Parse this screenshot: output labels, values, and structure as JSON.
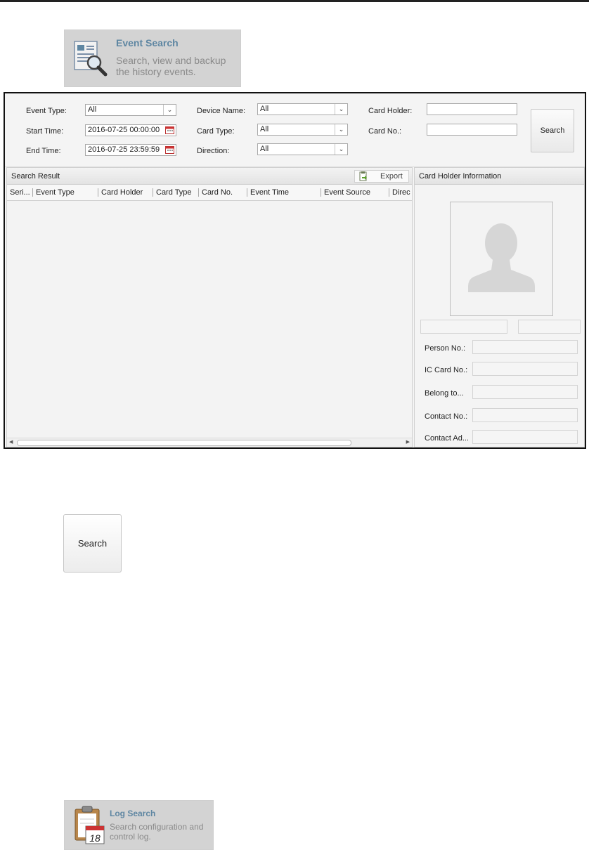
{
  "event_search_tile": {
    "title": "Event Search",
    "description": "Search, view and backup the history events.",
    "icon": "document-magnifier-icon"
  },
  "filters": {
    "event_type": {
      "label": "Event Type:",
      "value": "All"
    },
    "start_time": {
      "label": "Start Time:",
      "value": "2016-07-25 00:00:00"
    },
    "end_time": {
      "label": "End Time:",
      "value": "2016-07-25 23:59:59"
    },
    "device_name": {
      "label": "Device Name:",
      "value": "All"
    },
    "card_type": {
      "label": "Card Type:",
      "value": "All"
    },
    "direction": {
      "label": "Direction:",
      "value": "All"
    },
    "card_holder": {
      "label": "Card Holder:",
      "value": ""
    },
    "card_no": {
      "label": "Card No.:",
      "value": ""
    },
    "search_label": "Search"
  },
  "search_result": {
    "title": "Search Result",
    "export_label": "Export",
    "columns": [
      "Seri...",
      "Event Type",
      "Card Holder",
      "Card Type",
      "Card No.",
      "Event Time",
      "Event Source",
      "Direc"
    ]
  },
  "card_holder_info": {
    "title": "Card Holder Information",
    "fields": [
      "Person No.:",
      "IC Card No.:",
      "Belong to...",
      "Contact No.:",
      "Contact Ad..."
    ]
  },
  "search_button_label": "Search",
  "log_search_tile": {
    "title": "Log Search",
    "description": "Search configuration and control log.",
    "icon": "calendar-clipboard-icon",
    "calendar_day": "18"
  }
}
